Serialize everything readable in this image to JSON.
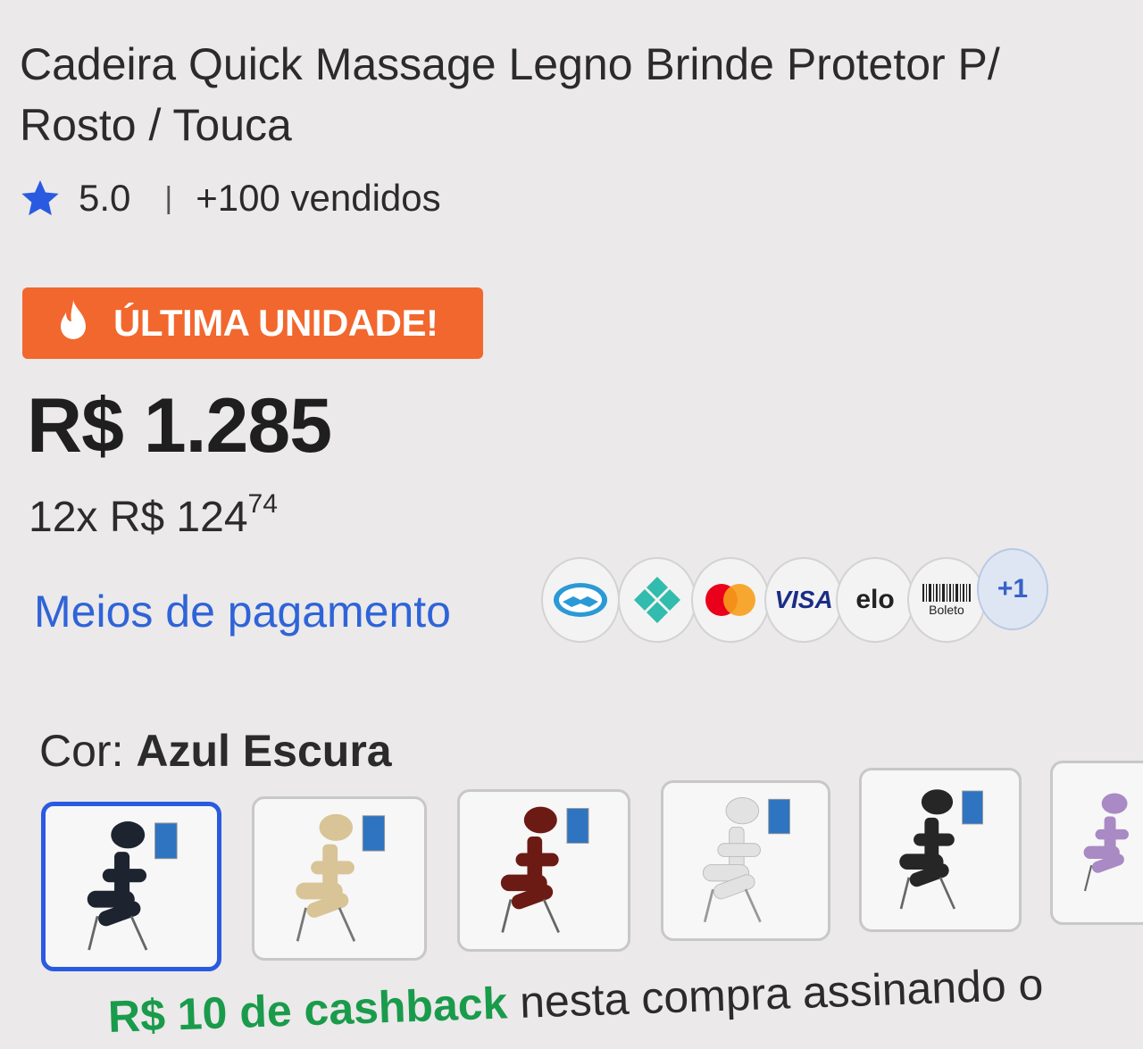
{
  "product": {
    "title": "Cadeira Quick Massage Legno Brinde Protetor P/ Rosto / Touca",
    "rating": "5.0",
    "separator": "|",
    "sold": "+100 vendidos",
    "badge": "ÚLTIMA UNIDADE!",
    "price": "R$ 1.285",
    "installments_prefix": "12x R$ 124",
    "installments_cents": "74"
  },
  "payment": {
    "label": "Meios de pagamento",
    "methods": [
      {
        "name": "mercado-pago",
        "icon": "handshake-icon",
        "color": "#2a9ad6"
      },
      {
        "name": "pix",
        "icon": "pix-icon",
        "color": "#32bcad"
      },
      {
        "name": "mastercard",
        "icon": "mastercard-icon",
        "color": "#eb001b"
      },
      {
        "name": "visa",
        "label": "VISA",
        "color": "#1a1f71"
      },
      {
        "name": "elo",
        "label": "elo"
      },
      {
        "name": "boleto",
        "label": "Boleto"
      }
    ],
    "more": "+1"
  },
  "color": {
    "label": "Cor:",
    "selected": "Azul Escura",
    "options": [
      {
        "name": "azul-escura",
        "color": "#1d2430",
        "selected": true
      },
      {
        "name": "bege",
        "color": "#d8c497"
      },
      {
        "name": "vinho",
        "color": "#6b1b14"
      },
      {
        "name": "branca",
        "color": "#e5e5e5"
      },
      {
        "name": "preta",
        "color": "#262626"
      },
      {
        "name": "lilas",
        "color": "#a98ac4"
      }
    ]
  },
  "cashback": {
    "amount": "R$ 10 de cashback",
    "text": " nesta compra assinando o"
  },
  "colors": {
    "accent_blue": "#2f64d8",
    "badge_orange": "#f2672d",
    "star_blue": "#2a5ae0",
    "cashback_green": "#1a9b4b"
  }
}
